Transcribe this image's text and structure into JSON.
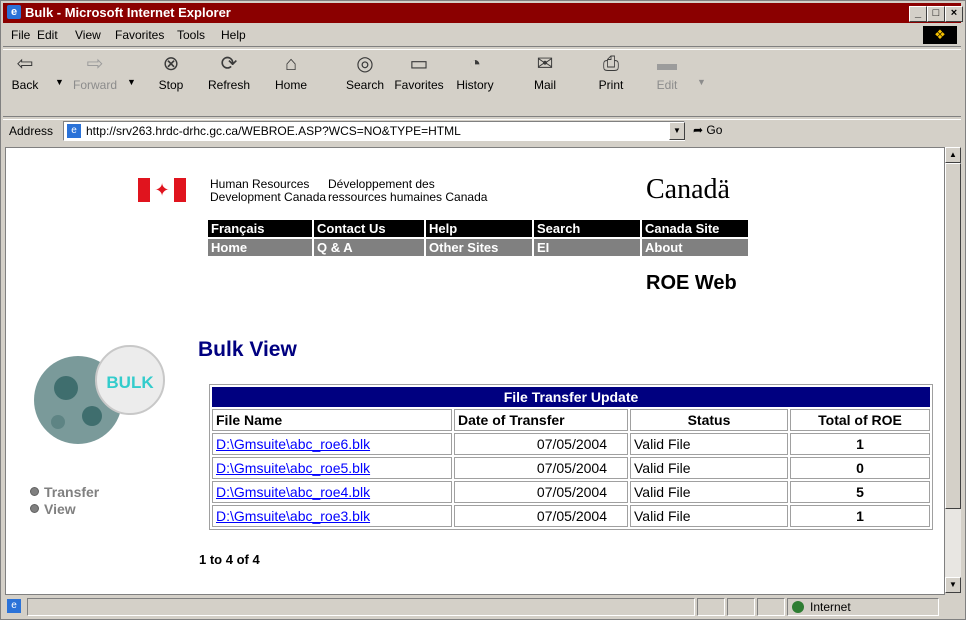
{
  "window": {
    "title": "Bulk - Microsoft Internet Explorer"
  },
  "menu": [
    "File",
    "Edit",
    "View",
    "Favorites",
    "Tools",
    "Help"
  ],
  "toolbar": [
    {
      "label": "Back",
      "icon": "back-arrow-icon",
      "enabled": true
    },
    {
      "label": "Forward",
      "icon": "forward-arrow-icon",
      "enabled": false
    },
    {
      "label": "Stop",
      "icon": "stop-icon",
      "enabled": true
    },
    {
      "label": "Refresh",
      "icon": "refresh-icon",
      "enabled": true
    },
    {
      "label": "Home",
      "icon": "home-icon",
      "enabled": true
    },
    {
      "label": "Search",
      "icon": "search-icon",
      "enabled": true
    },
    {
      "label": "Favorites",
      "icon": "favorites-icon",
      "enabled": true
    },
    {
      "label": "History",
      "icon": "history-icon",
      "enabled": true
    },
    {
      "label": "Mail",
      "icon": "mail-icon",
      "enabled": true
    },
    {
      "label": "Print",
      "icon": "print-icon",
      "enabled": true
    },
    {
      "label": "Edit",
      "icon": "edit-icon",
      "enabled": false
    }
  ],
  "address": {
    "label": "Address",
    "url": "http://srv263.hrdc-drhc.gc.ca/WEBROE.ASP?WCS=NO&TYPE=HTML",
    "go_label": "Go"
  },
  "header": {
    "dept_en_1": "Human Resources",
    "dept_en_2": "Development Canada",
    "dept_fr_1": "Développement des",
    "dept_fr_2": "ressources humaines Canada",
    "wordmark": "Canadä"
  },
  "nav": {
    "row1": [
      "Français",
      "Contact Us",
      "Help",
      "Search",
      "Canada Site"
    ],
    "row2": [
      "Home",
      "Q & A",
      "Other Sites",
      "EI",
      "About"
    ]
  },
  "app_name": "ROE Web",
  "page_title": "Bulk View",
  "logo_text": "BULK",
  "left_nav": [
    "Transfer",
    "View"
  ],
  "table": {
    "caption": "File Transfer Update",
    "headers": [
      "File Name",
      "Date of Transfer",
      "Status",
      "Total of ROE"
    ],
    "rows": [
      {
        "file": "D:\\Gmsuite\\abc_roe6.blk",
        "date": "07/05/2004",
        "status": "Valid File",
        "total": "1"
      },
      {
        "file": "D:\\Gmsuite\\abc_roe5.blk",
        "date": "07/05/2004",
        "status": "Valid File",
        "total": "0"
      },
      {
        "file": "D:\\Gmsuite\\abc_roe4.blk",
        "date": "07/05/2004",
        "status": "Valid File",
        "total": "5"
      },
      {
        "file": "D:\\Gmsuite\\abc_roe3.blk",
        "date": "07/05/2004",
        "status": "Valid File",
        "total": "1"
      }
    ]
  },
  "record_count": "1 to 4 of 4",
  "status": {
    "zone": "Internet"
  },
  "colors": {
    "titlebar": "#8b0000",
    "table_header": "#000080",
    "title": "#000080"
  }
}
